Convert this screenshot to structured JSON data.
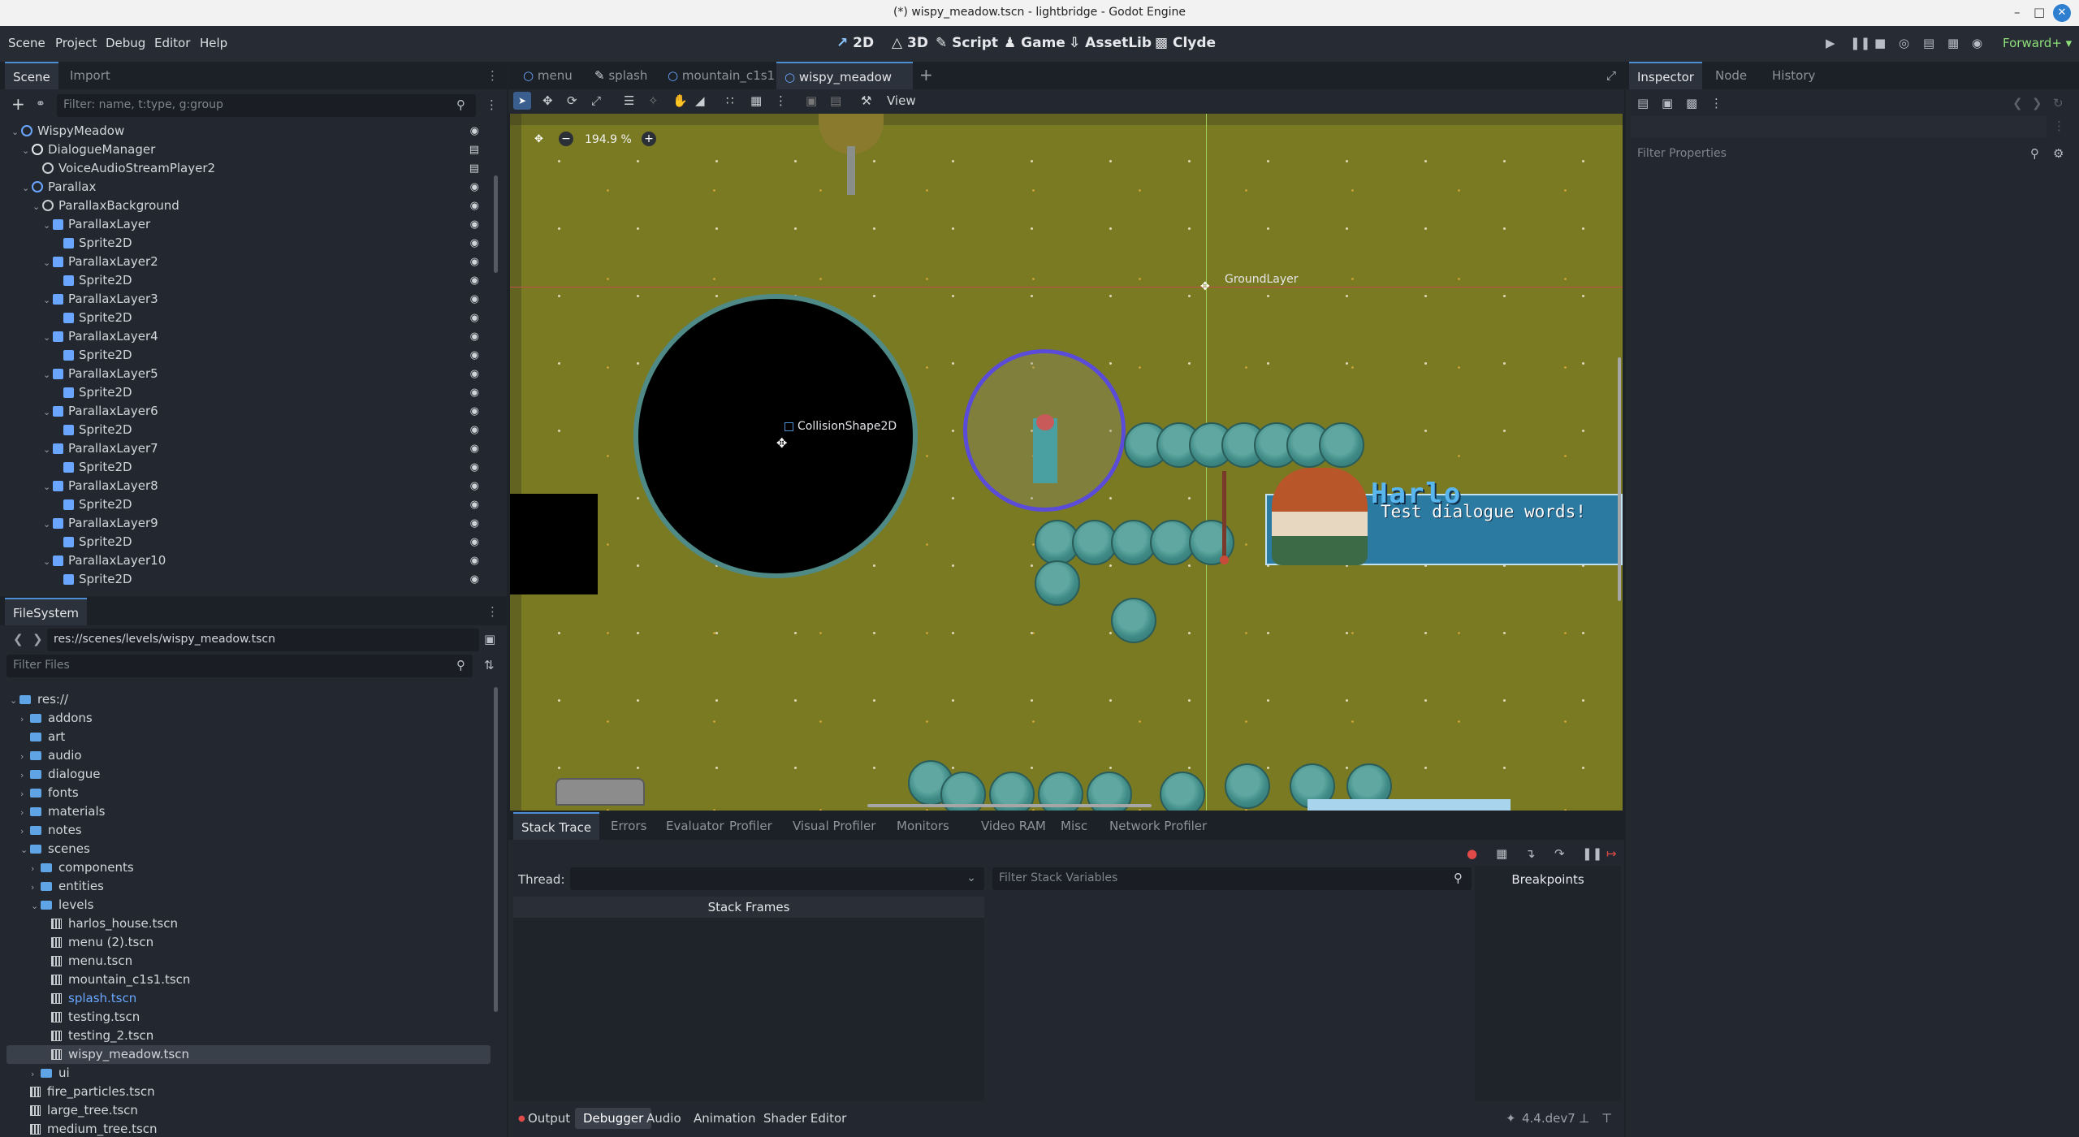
{
  "window": {
    "title": "(*) wispy_meadow.tscn - lightbridge - Godot Engine"
  },
  "menubar": {
    "menus": [
      "Scene",
      "Project",
      "Debug",
      "Editor",
      "Help"
    ],
    "modes": [
      "2D",
      "3D",
      "Script",
      "Game",
      "AssetLib",
      "Clyde"
    ],
    "active_mode": "2D",
    "renderer": "Forward+"
  },
  "scene_dock": {
    "tabs": [
      "Scene",
      "Import"
    ],
    "filter_placeholder": "Filter: name, t:type, g:group",
    "tree": [
      {
        "label": "WispyMeadow",
        "icon": "node2d-icon",
        "indent": 0,
        "expanded": true
      },
      {
        "label": "DialogueManager",
        "icon": "node-icon",
        "indent": 1,
        "expanded": true
      },
      {
        "label": "VoiceAudioStreamPlayer2",
        "icon": "audio-icon",
        "indent": 2
      },
      {
        "label": "Parallax",
        "icon": "node2d-icon",
        "indent": 1,
        "expanded": true
      },
      {
        "label": "ParallaxBackground",
        "icon": "parallax-bg-icon",
        "indent": 2,
        "expanded": true
      },
      {
        "label": "ParallaxLayer",
        "icon": "parallax-layer-icon",
        "indent": 3,
        "expanded": true
      },
      {
        "label": "Sprite2D",
        "icon": "sprite-icon",
        "indent": 4
      },
      {
        "label": "ParallaxLayer2",
        "icon": "parallax-layer-icon",
        "indent": 3,
        "expanded": true
      },
      {
        "label": "Sprite2D",
        "icon": "sprite-icon",
        "indent": 4
      },
      {
        "label": "ParallaxLayer3",
        "icon": "parallax-layer-icon",
        "indent": 3,
        "expanded": true
      },
      {
        "label": "Sprite2D",
        "icon": "sprite-icon",
        "indent": 4
      },
      {
        "label": "ParallaxLayer4",
        "icon": "parallax-layer-icon",
        "indent": 3,
        "expanded": true
      },
      {
        "label": "Sprite2D",
        "icon": "sprite-icon",
        "indent": 4
      },
      {
        "label": "ParallaxLayer5",
        "icon": "parallax-layer-icon",
        "indent": 3,
        "expanded": true
      },
      {
        "label": "Sprite2D",
        "icon": "sprite-icon",
        "indent": 4
      },
      {
        "label": "ParallaxLayer6",
        "icon": "parallax-layer-icon",
        "indent": 3,
        "expanded": true
      },
      {
        "label": "Sprite2D",
        "icon": "sprite-icon",
        "indent": 4
      },
      {
        "label": "ParallaxLayer7",
        "icon": "parallax-layer-icon",
        "indent": 3,
        "expanded": true
      },
      {
        "label": "Sprite2D",
        "icon": "sprite-icon",
        "indent": 4
      },
      {
        "label": "ParallaxLayer8",
        "icon": "parallax-layer-icon",
        "indent": 3,
        "expanded": true
      },
      {
        "label": "Sprite2D",
        "icon": "sprite-icon",
        "indent": 4
      },
      {
        "label": "ParallaxLayer9",
        "icon": "parallax-layer-icon",
        "indent": 3,
        "expanded": true
      },
      {
        "label": "Sprite2D",
        "icon": "sprite-icon",
        "indent": 4
      },
      {
        "label": "ParallaxLayer10",
        "icon": "parallax-layer-icon",
        "indent": 3,
        "expanded": true
      },
      {
        "label": "Sprite2D",
        "icon": "sprite-icon",
        "indent": 4
      }
    ]
  },
  "filesystem": {
    "title": "FileSystem",
    "path": "res://scenes/levels/wispy_meadow.tscn",
    "filter_placeholder": "Filter Files",
    "items": [
      {
        "label": "res://",
        "type": "folder",
        "indent": 0,
        "expanded": true
      },
      {
        "label": "addons",
        "type": "folder",
        "indent": 1
      },
      {
        "label": "art",
        "type": "folder",
        "indent": 1,
        "leaf": true
      },
      {
        "label": "audio",
        "type": "folder",
        "indent": 1
      },
      {
        "label": "dialogue",
        "type": "folder",
        "indent": 1
      },
      {
        "label": "fonts",
        "type": "folder",
        "indent": 1
      },
      {
        "label": "materials",
        "type": "folder",
        "indent": 1
      },
      {
        "label": "notes",
        "type": "folder",
        "indent": 1
      },
      {
        "label": "scenes",
        "type": "folder",
        "indent": 1,
        "expanded": true
      },
      {
        "label": "components",
        "type": "folder",
        "indent": 2
      },
      {
        "label": "entities",
        "type": "folder",
        "indent": 2
      },
      {
        "label": "levels",
        "type": "folder",
        "indent": 2,
        "expanded": true
      },
      {
        "label": "harlos_house.tscn",
        "type": "scene",
        "indent": 3
      },
      {
        "label": "menu (2).tscn",
        "type": "scene",
        "indent": 3
      },
      {
        "label": "menu.tscn",
        "type": "scene",
        "indent": 3
      },
      {
        "label": "mountain_c1s1.tscn",
        "type": "scene",
        "indent": 3
      },
      {
        "label": "splash.tscn",
        "type": "scene",
        "indent": 3,
        "highlight": true
      },
      {
        "label": "testing.tscn",
        "type": "scene",
        "indent": 3
      },
      {
        "label": "testing_2.tscn",
        "type": "scene",
        "indent": 3
      },
      {
        "label": "wispy_meadow.tscn",
        "type": "scene",
        "indent": 3,
        "selected": true
      },
      {
        "label": "ui",
        "type": "folder",
        "indent": 2
      },
      {
        "label": "fire_particles.tscn",
        "type": "scene",
        "indent": 1
      },
      {
        "label": "large_tree.tscn",
        "type": "scene",
        "indent": 1
      },
      {
        "label": "medium_tree.tscn",
        "type": "scene",
        "indent": 1
      }
    ]
  },
  "editor_tabs": {
    "tabs": [
      "menu",
      "splash",
      "mountain_c1s1",
      "wispy_meadow"
    ],
    "active": "wispy_meadow"
  },
  "canvas_toolbar": {
    "view_label": "View",
    "zoom": "194.9 %"
  },
  "viewport": {
    "collision_label": "CollisionShape2D",
    "ground_label": "GroundLayer",
    "dialogue_name": "Harlo",
    "dialogue_text": "Test dialogue words!"
  },
  "inspector": {
    "tabs": [
      "Inspector",
      "Node",
      "History"
    ],
    "filter_placeholder": "Filter Properties"
  },
  "debugger": {
    "tabs": [
      "Stack Trace",
      "Errors",
      "Evaluator",
      "Profiler",
      "Visual Profiler",
      "Monitors",
      "Video RAM",
      "Misc",
      "Network Profiler"
    ],
    "thread_label": "Thread:",
    "stack_vars_placeholder": "Filter Stack Variables",
    "stack_frames_header": "Stack Frames",
    "breakpoints_header": "Breakpoints"
  },
  "bottom_panel": {
    "tabs": [
      "Output",
      "Debugger",
      "Audio",
      "Animation",
      "Shader Editor"
    ],
    "active": "Debugger",
    "version": "4.4.dev7"
  },
  "colors": {
    "accent": "#4e8fd4",
    "meadow": "#7a7a22",
    "selection_circle": "#5a4bd8"
  }
}
